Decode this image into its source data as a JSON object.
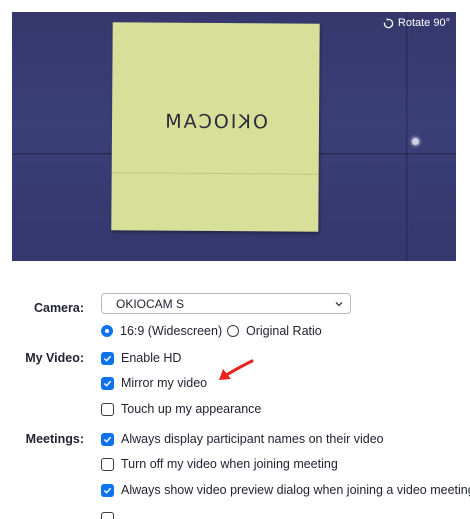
{
  "preview": {
    "rotate_label": "Rotate 90°",
    "note_text": "OKIOCAM"
  },
  "camera": {
    "label": "Camera:",
    "selected": "OKIOCAM S",
    "aspect_options": [
      {
        "label": "16:9 (Widescreen)",
        "selected": true
      },
      {
        "label": "Original Ratio",
        "selected": false
      }
    ]
  },
  "my_video": {
    "label": "My Video:",
    "options": [
      {
        "label": "Enable HD",
        "checked": true
      },
      {
        "label": "Mirror my video",
        "checked": true
      },
      {
        "label": "Touch up my appearance",
        "checked": false
      }
    ]
  },
  "meetings": {
    "label": "Meetings:",
    "options": [
      {
        "label": "Always display participant names on their video",
        "checked": true
      },
      {
        "label": "Turn off my video when joining meeting",
        "checked": false
      },
      {
        "label": "Always show video preview dialog when joining a video meeting",
        "checked": true
      }
    ]
  },
  "colors": {
    "accent": "#0e72ed",
    "arrow": "#e8231f",
    "preview_bg": "#3a3e76",
    "note": "#d7df98"
  }
}
